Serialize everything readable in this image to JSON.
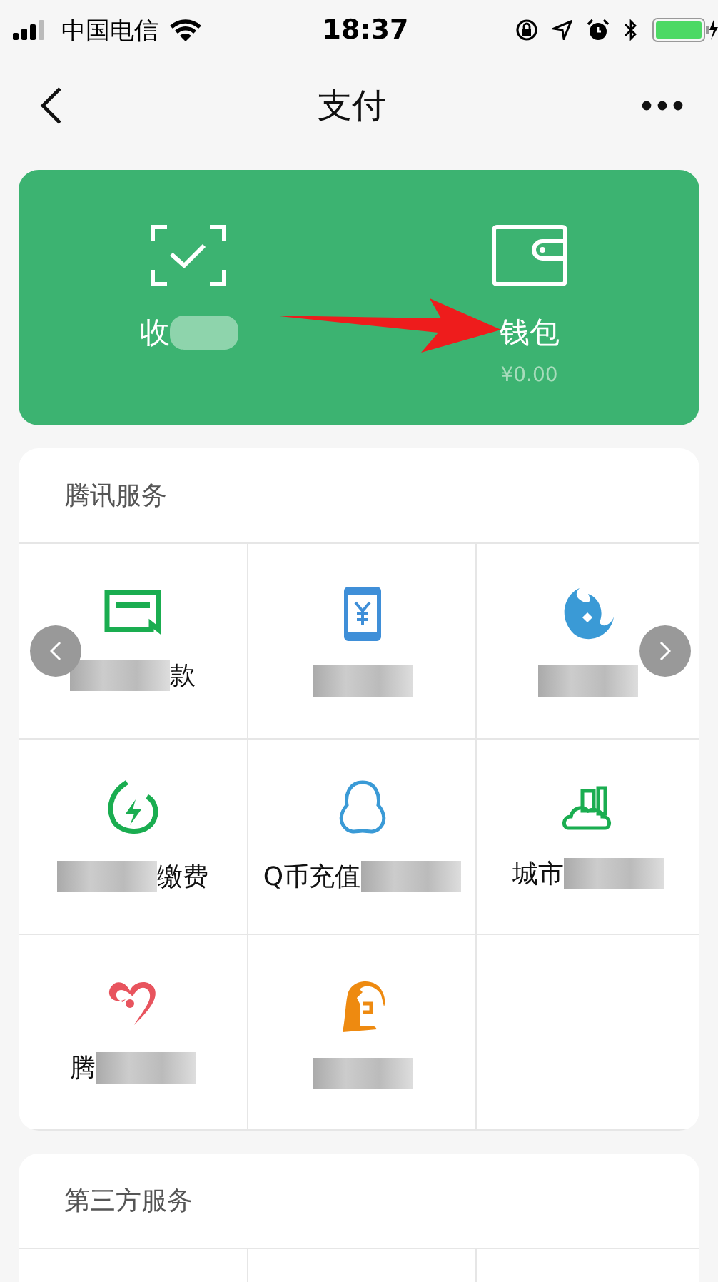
{
  "status_bar": {
    "carrier": "中国电信",
    "time": "18:37"
  },
  "nav": {
    "title": "支付"
  },
  "top_card": [
    {
      "kind": "scan",
      "label_before": "收",
      "blurred": true
    },
    {
      "kind": "wallet",
      "label_before": "钱包",
      "blurred": false,
      "amount": "¥0.00"
    }
  ],
  "sections": [
    {
      "title": "腾讯服务",
      "tiles": [
        {
          "blurred": true,
          "label_after": "款"
        },
        {
          "blurred": true
        },
        {
          "blurred": true
        },
        {
          "blurred": true,
          "label_after": "缴费"
        },
        {
          "blurred": true,
          "label_before": "Q币充值"
        },
        {
          "blurred": true,
          "label_before": "城市"
        },
        {
          "blurred": true,
          "label_before": "腾"
        },
        {
          "blurred": true
        }
      ]
    },
    {
      "title": "第三方服务"
    }
  ]
}
